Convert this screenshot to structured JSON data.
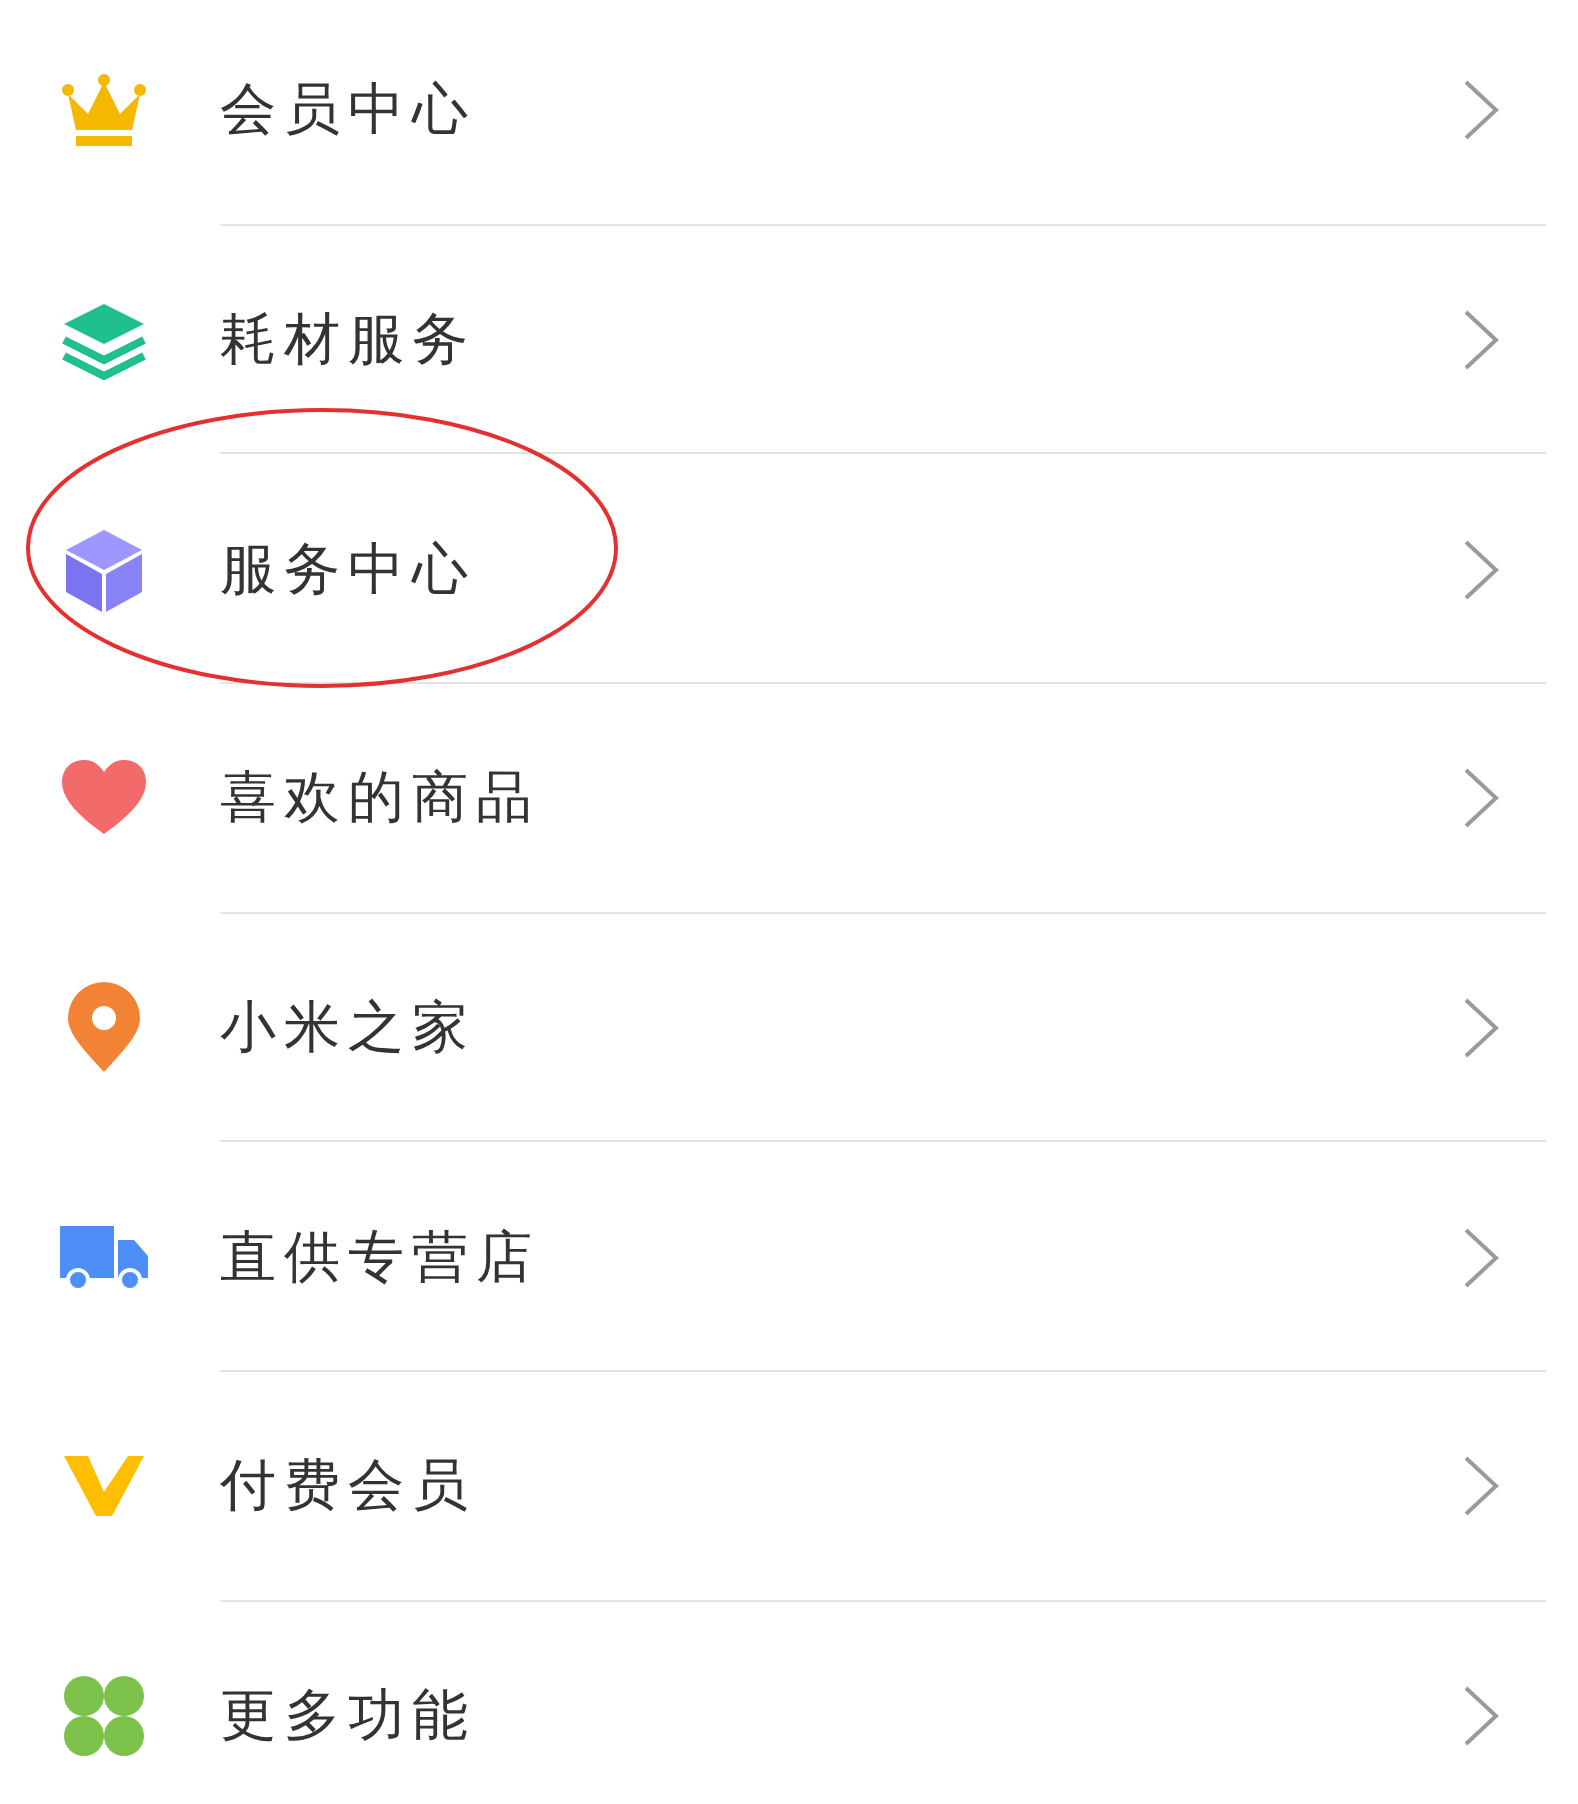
{
  "menu": [
    {
      "label": "会员中心",
      "circled": false
    },
    {
      "label": "耗材服务",
      "circled": false
    },
    {
      "label": "服务中心",
      "circled": true
    },
    {
      "label": "喜欢的商品",
      "circled": false
    },
    {
      "label": "小米之家",
      "circled": false
    },
    {
      "label": "直供专营店",
      "circled": false
    },
    {
      "label": "付费会员",
      "circled": false
    },
    {
      "label": "更多功能",
      "circled": false
    }
  ]
}
